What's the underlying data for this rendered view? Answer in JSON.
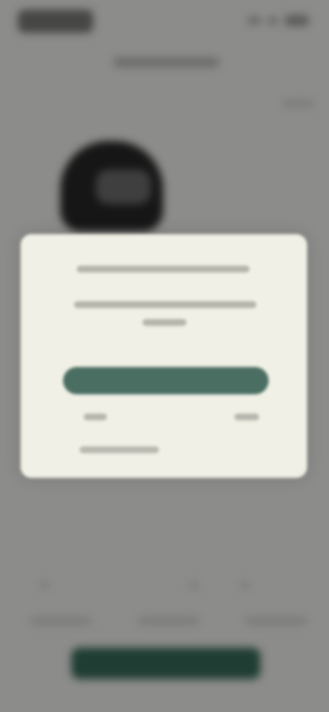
{
  "status_bar": {
    "time": "",
    "battery": ""
  },
  "header": {
    "title": ""
  },
  "footer": {
    "primary_button_label": ""
  },
  "modal": {
    "title": "",
    "body": "",
    "primary_button_label": "",
    "secondary_left": "",
    "secondary_right": "",
    "note": ""
  }
}
